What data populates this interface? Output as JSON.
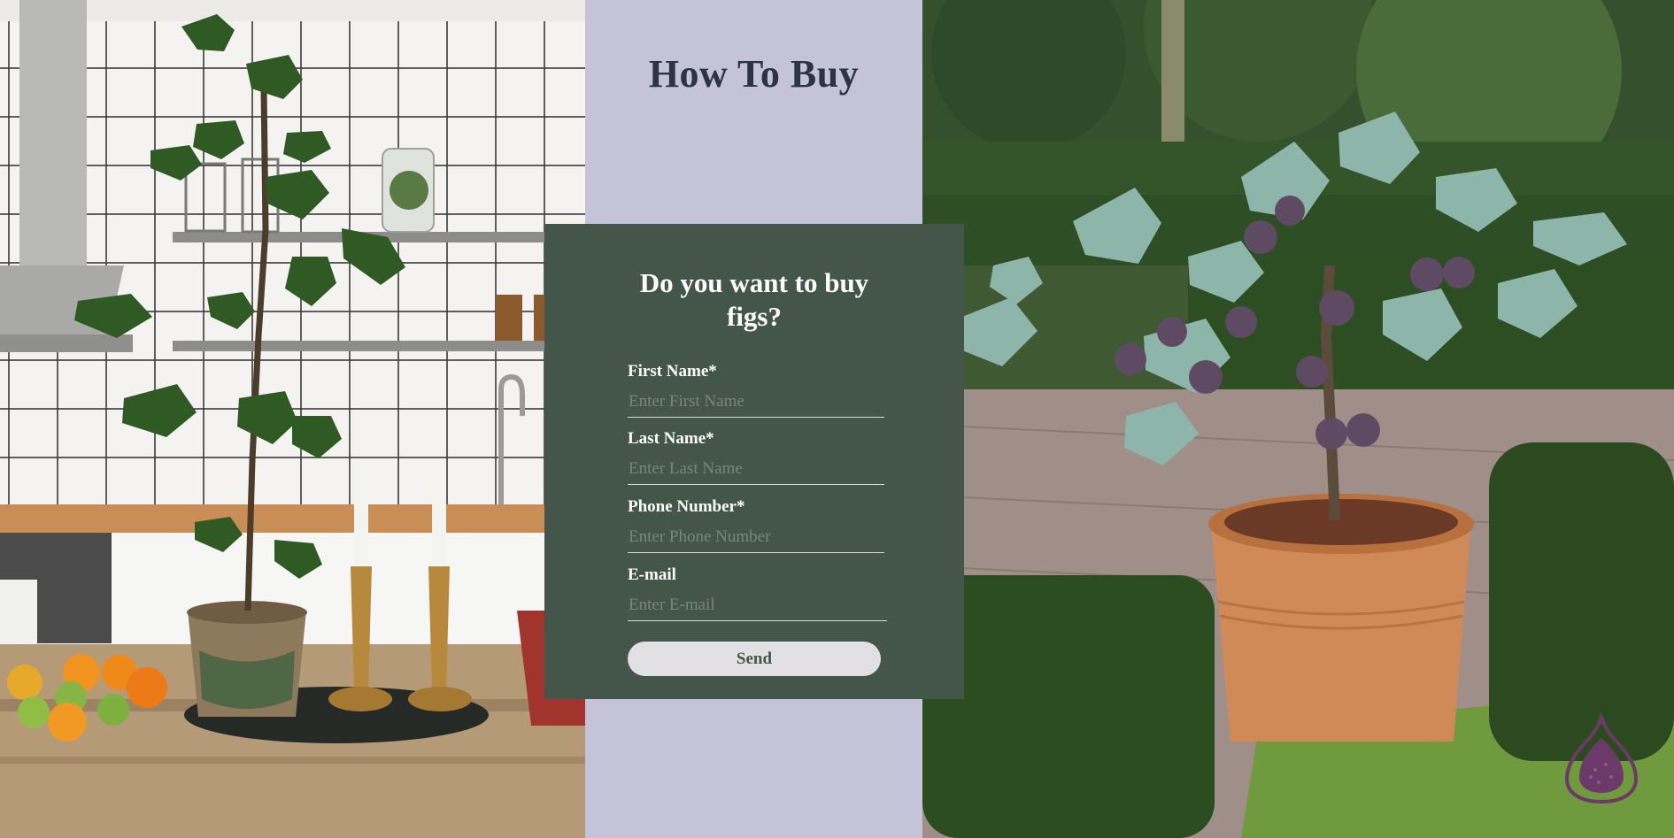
{
  "header": {
    "title": "How To Buy"
  },
  "form": {
    "heading_line1": "Do you want to buy",
    "heading_line2": "figs?",
    "fields": [
      {
        "label": "First Name*",
        "placeholder": "Enter First Name"
      },
      {
        "label": "Last Name*",
        "placeholder": "Enter Last Name"
      },
      {
        "label": "Phone Number*",
        "placeholder": "Enter Phone Number"
      },
      {
        "label": "E-mail",
        "placeholder": "Enter E-mail"
      }
    ],
    "send_label": "Send"
  },
  "images": {
    "left": "kitchen-with-fig-tree",
    "right": "potted-fig-tree-in-garden",
    "logo": "fig-logo-icon"
  },
  "colors": {
    "middle_background": "#c4c3d7",
    "title_text": "#2c3442",
    "form_background": "#44564a",
    "button_background": "#e1e1e3",
    "logo": "#6b3a68"
  }
}
